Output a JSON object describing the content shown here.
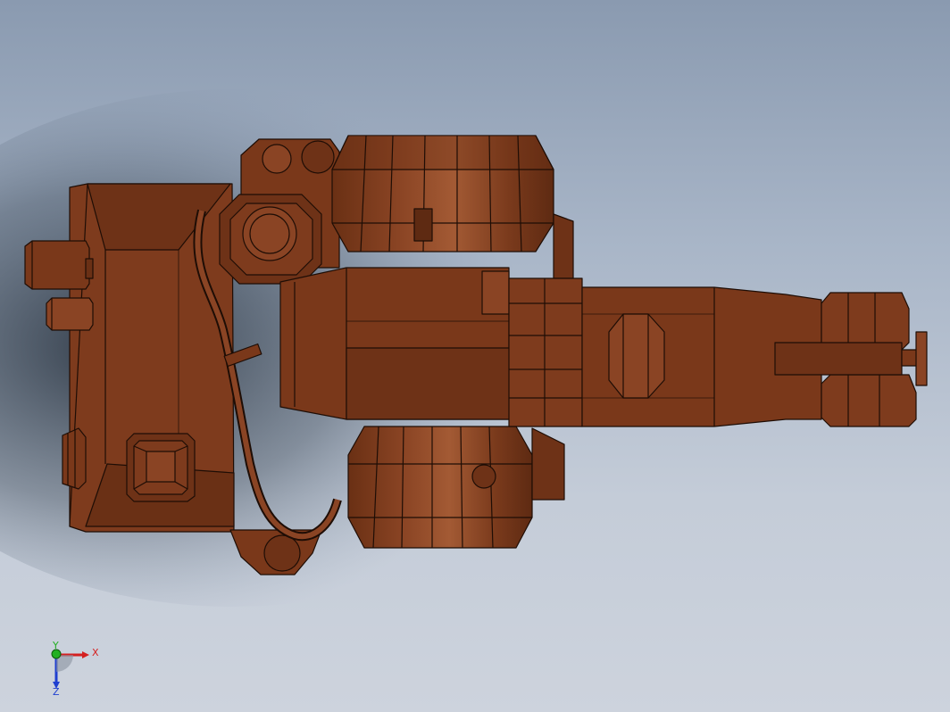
{
  "viewport": {
    "background_top": "#8a9ab0",
    "background_bottom": "#cdd3dd",
    "model_color": "#7a3a1c",
    "model_edge_color": "#1e0d05"
  },
  "triad": {
    "x_label": "X",
    "y_label": "Y",
    "z_label": "Z",
    "x_color": "#d42020",
    "y_color": "#22b022",
    "z_color": "#2040d0"
  }
}
